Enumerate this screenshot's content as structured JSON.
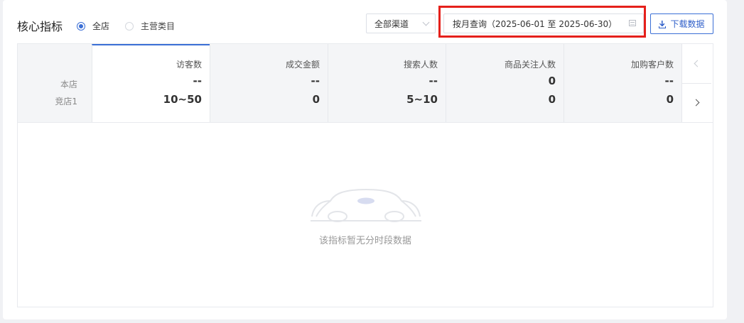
{
  "header": {
    "title": "核心指标",
    "scope_options": [
      {
        "label": "全店",
        "selected": true
      },
      {
        "label": "主营类目",
        "selected": false
      }
    ],
    "channel_select": "全部渠道",
    "date_range": "按月查询（2025-06-01 至 2025-06-30）",
    "download_label": "下载数据",
    "accent_color": "#3b6fd6",
    "highlight_color": "#e5201b"
  },
  "rows": [
    "本店",
    "竞店1"
  ],
  "metrics": [
    {
      "name": "访客数",
      "store": "--",
      "competitor": "10~50",
      "active": true
    },
    {
      "name": "成交金额",
      "store": "--",
      "competitor": "0",
      "active": false
    },
    {
      "name": "搜索人数",
      "store": "--",
      "competitor": "5~10",
      "active": false
    },
    {
      "name": "商品关注人数",
      "store": "0",
      "competitor": "0",
      "active": false
    },
    {
      "name": "加购客户数",
      "store": "--",
      "competitor": "0",
      "active": false
    }
  ],
  "empty_state": {
    "message": "该指标暂无分时段数据",
    "icon": "dog-mascot-icon"
  }
}
